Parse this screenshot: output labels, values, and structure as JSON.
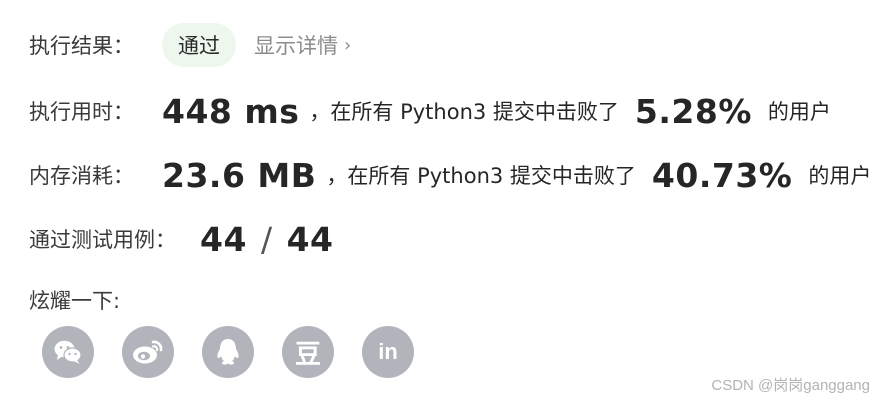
{
  "result": {
    "label": "执行结果：",
    "status": "通过",
    "details_link": "显示详情",
    "chevron": "›"
  },
  "runtime": {
    "label": "执行用时：",
    "value": "448 ms",
    "prefix": "，在所有 Python3 提交中击败了",
    "percent": "5.28%",
    "suffix": "的用户"
  },
  "memory": {
    "label": "内存消耗：",
    "value": "23.6 MB",
    "prefix": "，在所有 Python3 提交中击败了",
    "percent": "40.73%",
    "suffix": "的用户"
  },
  "testcases": {
    "label": "通过测试用例：",
    "passed": "44",
    "separator": "/",
    "total": "44"
  },
  "share": {
    "label": "炫耀一下:",
    "icons": [
      "wechat-icon",
      "weibo-icon",
      "qq-icon",
      "douban-icon",
      "linkedin-icon"
    ],
    "douban_glyph": "豆",
    "linkedin_glyph": "in",
    "icon_color": "#b1b4bb"
  },
  "watermark": "CSDN @岗岗ganggang",
  "colors": {
    "pass_pill_bg": "#eef7ee",
    "muted_text": "#8c8c8c"
  }
}
